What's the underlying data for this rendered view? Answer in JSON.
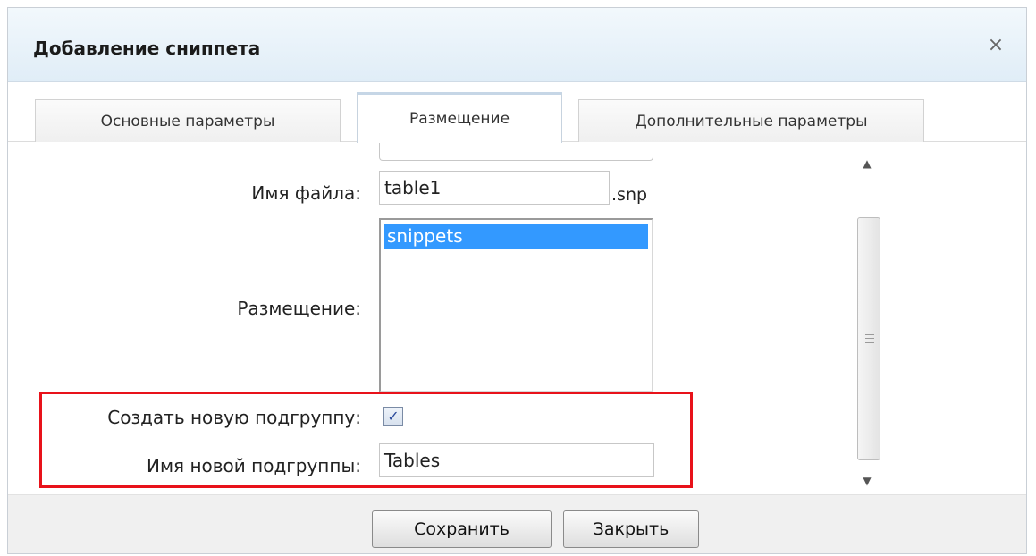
{
  "dialog": {
    "title": "Добавление сниппета",
    "close_glyph": "×"
  },
  "tabs": [
    {
      "label": "Основные параметры",
      "active": false
    },
    {
      "label": "Размещение",
      "active": true
    },
    {
      "label": "Дополнительные параметры",
      "active": false
    }
  ],
  "form": {
    "file_name_label": "Имя файла:",
    "file_name_value": "table1",
    "file_ext": ".snp",
    "placement_label": "Размещение:",
    "placement_options": [
      "snippets"
    ],
    "placement_selected": "snippets",
    "create_subgroup_label": "Создать новую подгруппу:",
    "create_subgroup_checked": true,
    "checkbox_glyph": "✓",
    "subgroup_name_label": "Имя новой подгруппы:",
    "subgroup_name_value": "Tables"
  },
  "highlight_color": "#e8121a",
  "selection_color": "#3399ff",
  "footer": {
    "save_label": "Сохранить",
    "close_label": "Закрыть"
  }
}
